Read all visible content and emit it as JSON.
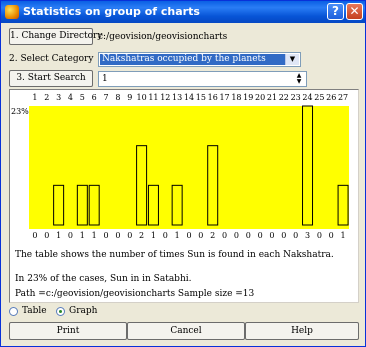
{
  "window": {
    "title": "Statistics on group of charts",
    "help_glyph": "?",
    "close_glyph": "✕"
  },
  "directory": {
    "button_label": "1. Change Directory",
    "path": "c:/geovision/geovisioncharts"
  },
  "category": {
    "label": "2. Select Category",
    "selected": "Nakshatras occupied by the planets",
    "dropdown_icon": "chevron-down-icon"
  },
  "search": {
    "button_label": "3. Start Search",
    "value": "1"
  },
  "chart_data": {
    "type": "bar",
    "categories": [
      "1",
      "2",
      "3",
      "4",
      "5",
      "6",
      "7",
      "8",
      "9",
      "10",
      "11",
      "12",
      "13",
      "14",
      "15",
      "16",
      "17",
      "18",
      "19",
      "20",
      "21",
      "22",
      "23",
      "24",
      "25",
      "26",
      "27"
    ],
    "values": [
      0,
      0,
      1,
      0,
      1,
      1,
      0,
      0,
      0,
      2,
      1,
      0,
      1,
      0,
      0,
      2,
      0,
      0,
      0,
      0,
      0,
      0,
      0,
      3,
      0,
      0,
      1
    ],
    "y_max_label": "23%",
    "ylim": [
      0,
      3
    ],
    "background": "#ffff00",
    "bar_fill": "#ffff00",
    "bar_stroke": "#000000"
  },
  "info": {
    "description": "The table shows the number of times Sun is found in each Nakshatra.",
    "result": "In 23% of the cases, Sun in  in Satabhi.",
    "path_line": "Path =c:/geovision/geovisioncharts   Sample size =13"
  },
  "view_mode": {
    "table_label": "Table",
    "graph_label": "Graph",
    "selected": "Graph"
  },
  "actions": {
    "print_label": "Print",
    "cancel_label": "Cancel",
    "help_label": "Help"
  }
}
